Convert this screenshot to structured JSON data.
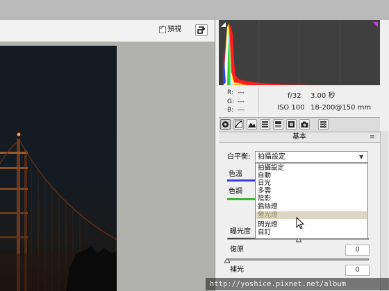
{
  "preview": {
    "checkbox_mark": "✓",
    "label": "預視",
    "fullscreen_icon": "fullscreen-toggle-icon"
  },
  "readout": {
    "r_label": "R:",
    "r_value": "---",
    "g_label": "G:",
    "g_value": "---",
    "b_label": "B:",
    "b_value": "---",
    "aperture": "f/32",
    "shutter": "3.00 秒",
    "iso": "ISO 100",
    "lens": "18-200@150 mm"
  },
  "tabs": [
    {
      "icon": "basic-aperture-icon",
      "active": true
    },
    {
      "icon": "tone-curve-icon",
      "active": false
    },
    {
      "icon": "detail-mountain-icon",
      "active": false
    },
    {
      "icon": "hsl-icon",
      "active": false
    },
    {
      "icon": "split-toning-icon",
      "active": false
    },
    {
      "icon": "lens-corrections-icon",
      "active": false
    },
    {
      "icon": "camera-calibration-icon",
      "active": false
    },
    {
      "icon": "presets-icon",
      "active": false
    }
  ],
  "section": {
    "title": "基本",
    "menu_icon": "≡"
  },
  "white_balance": {
    "label": "白平衡:",
    "selected": "拍攝設定",
    "arrow": "▼",
    "options": [
      "拍攝設定",
      "自動",
      "日光",
      "多雲",
      "陰影",
      "鎢絲燈",
      "螢光燈",
      "閃光燈",
      "自訂"
    ],
    "highlighted_index": 6
  },
  "controls": {
    "temperature_label": "色溫",
    "tint_label": "色調",
    "exposure_label": "曝光度",
    "recovery_label": "復原",
    "recovery_value": "0",
    "fill_label": "補光",
    "fill_value": "0"
  },
  "colors": {
    "temperature_track": "#3c3cdc",
    "tint_track": "#3cb43c",
    "highlight": "#dcd5c2"
  },
  "watermark": "http://yoshice.pixnet.net/album"
}
